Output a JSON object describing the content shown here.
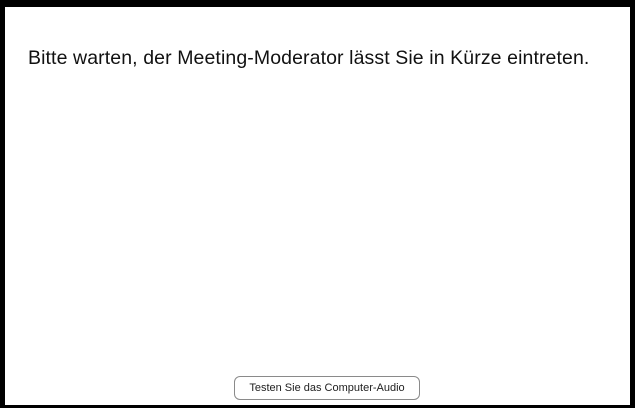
{
  "lobby": {
    "message": "Bitte warten, der Meeting-Moderator lässt Sie in Kürze eintreten.",
    "audio_test_button_label": "Testen Sie das Computer-Audio"
  }
}
